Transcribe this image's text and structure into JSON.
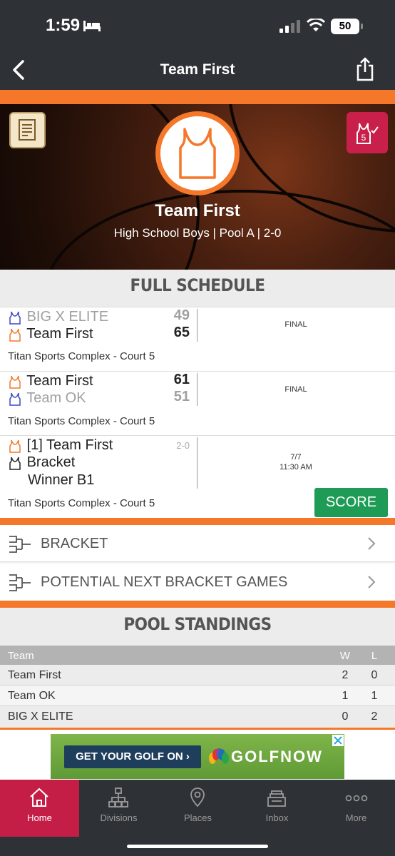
{
  "status_bar": {
    "time": "1:59",
    "battery": "50"
  },
  "nav": {
    "title": "Team First"
  },
  "hero": {
    "team_name": "Team First",
    "subtitle": "High School Boys | Pool A | 2-0",
    "badge_number": "5"
  },
  "schedule": {
    "header": "FULL SCHEDULE",
    "games": [
      {
        "team1": "BIG X ELITE",
        "score1": "49",
        "team1_color": "#3a49c9",
        "team2": "Team First",
        "score2": "65",
        "team2_color": "#f5772a",
        "status": "FINAL",
        "venue": "Titan Sports Complex - Court 5"
      },
      {
        "team1": "Team First",
        "score1": "61",
        "team1_color": "#f5772a",
        "team2": "Team OK",
        "score2": "51",
        "team2_color": "#3a49c9",
        "status": "FINAL",
        "venue": "Titan Sports Complex - Court 5"
      },
      {
        "team1": "[1] Team First",
        "record": "2-0",
        "team1_color": "#f5772a",
        "team2_line1": "Bracket",
        "team2_line2": "Winner B1",
        "date": "7/7",
        "time": "11:30 AM",
        "venue": "Titan Sports Complex - Court 5",
        "score_button": "SCORE"
      }
    ]
  },
  "links": [
    {
      "label": "BRACKET"
    },
    {
      "label": "POTENTIAL NEXT BRACKET GAMES"
    }
  ],
  "standings": {
    "header": "POOL STANDINGS",
    "columns": {
      "team": "Team",
      "w": "W",
      "l": "L"
    },
    "rows": [
      {
        "team": "Team First",
        "w": "2",
        "l": "0"
      },
      {
        "team": "Team OK",
        "w": "1",
        "l": "1"
      },
      {
        "team": "BIG X ELITE",
        "w": "0",
        "l": "2"
      }
    ]
  },
  "ad": {
    "cta": "GET YOUR GOLF ON  ›",
    "brand": "GOLFNOW"
  },
  "tabs": [
    {
      "label": "Home",
      "icon": "home-icon",
      "active": true
    },
    {
      "label": "Divisions",
      "icon": "divisions-icon"
    },
    {
      "label": "Places",
      "icon": "map-pin-icon"
    },
    {
      "label": "Inbox",
      "icon": "inbox-icon"
    },
    {
      "label": "More",
      "icon": "more-icon"
    }
  ],
  "colors": {
    "accent": "#f5772a",
    "nav": "#2e3236",
    "active_tab": "#c41e47",
    "score_button": "#1e9c55"
  }
}
